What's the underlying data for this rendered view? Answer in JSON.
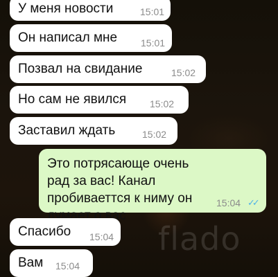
{
  "messages": [
    {
      "text": "У меня новости",
      "time": "15:01"
    },
    {
      "text": "Он написал мне",
      "time": "15:01"
    },
    {
      "text": "Позвал на свидание",
      "time": "15:02"
    },
    {
      "text": "Но сам не явился",
      "time": "15:02"
    },
    {
      "text": "Заставил ждать",
      "time": "15:02"
    },
    {
      "text": "Это потрясающе очень рад за вас! Канал пробиваеттся к ниму он думает о вас",
      "time": "15:04",
      "status": "read-double-check-icon"
    },
    {
      "text": "Спасибо",
      "time": "15:04"
    },
    {
      "text": "Вам",
      "time": "15:04"
    }
  ],
  "watermark": "flado",
  "colors": {
    "incoming": "#ffffff",
    "outgoing": "#dcf8c6",
    "read_ticks": "#4fb3e8"
  }
}
